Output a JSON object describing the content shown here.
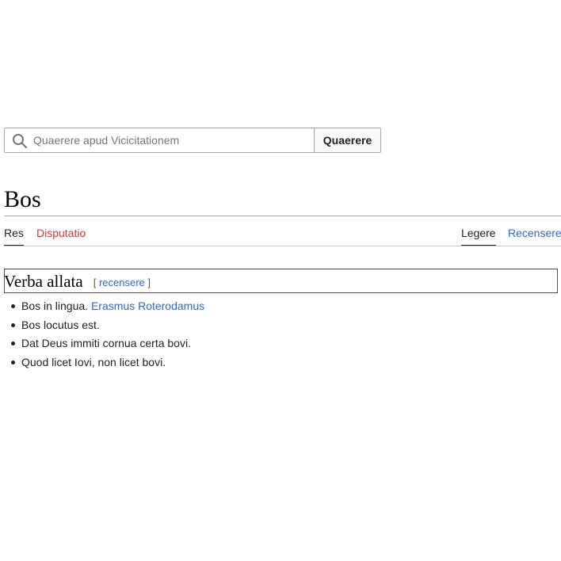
{
  "search": {
    "placeholder": "Quaerere apud Vicicitationem",
    "button_label": "Quaerere"
  },
  "page": {
    "title": "Bos"
  },
  "tabs": {
    "left": [
      {
        "label": "Res",
        "selected": true
      },
      {
        "label": "Disputatio",
        "selected": false
      }
    ],
    "right": [
      {
        "label": "Legere",
        "selected": true
      },
      {
        "label": "Recensere",
        "selected": false
      }
    ]
  },
  "section": {
    "heading": "Verba allata",
    "edit_open": "[",
    "edit_label": "recensere",
    "edit_close": "]"
  },
  "quotes": [
    {
      "text": "Bos in lingua. ",
      "link": "Erasmus Roterodamus"
    },
    {
      "text": "Bos locutus est."
    },
    {
      "text": "Dat Deus immiti cornua certa bovi."
    },
    {
      "text": "Quod licet Iovi, non licet bovi."
    }
  ],
  "colors": {
    "link": "#3366cc",
    "redlink": "#d33",
    "heading_border": "#b32424",
    "text": "#202122"
  }
}
